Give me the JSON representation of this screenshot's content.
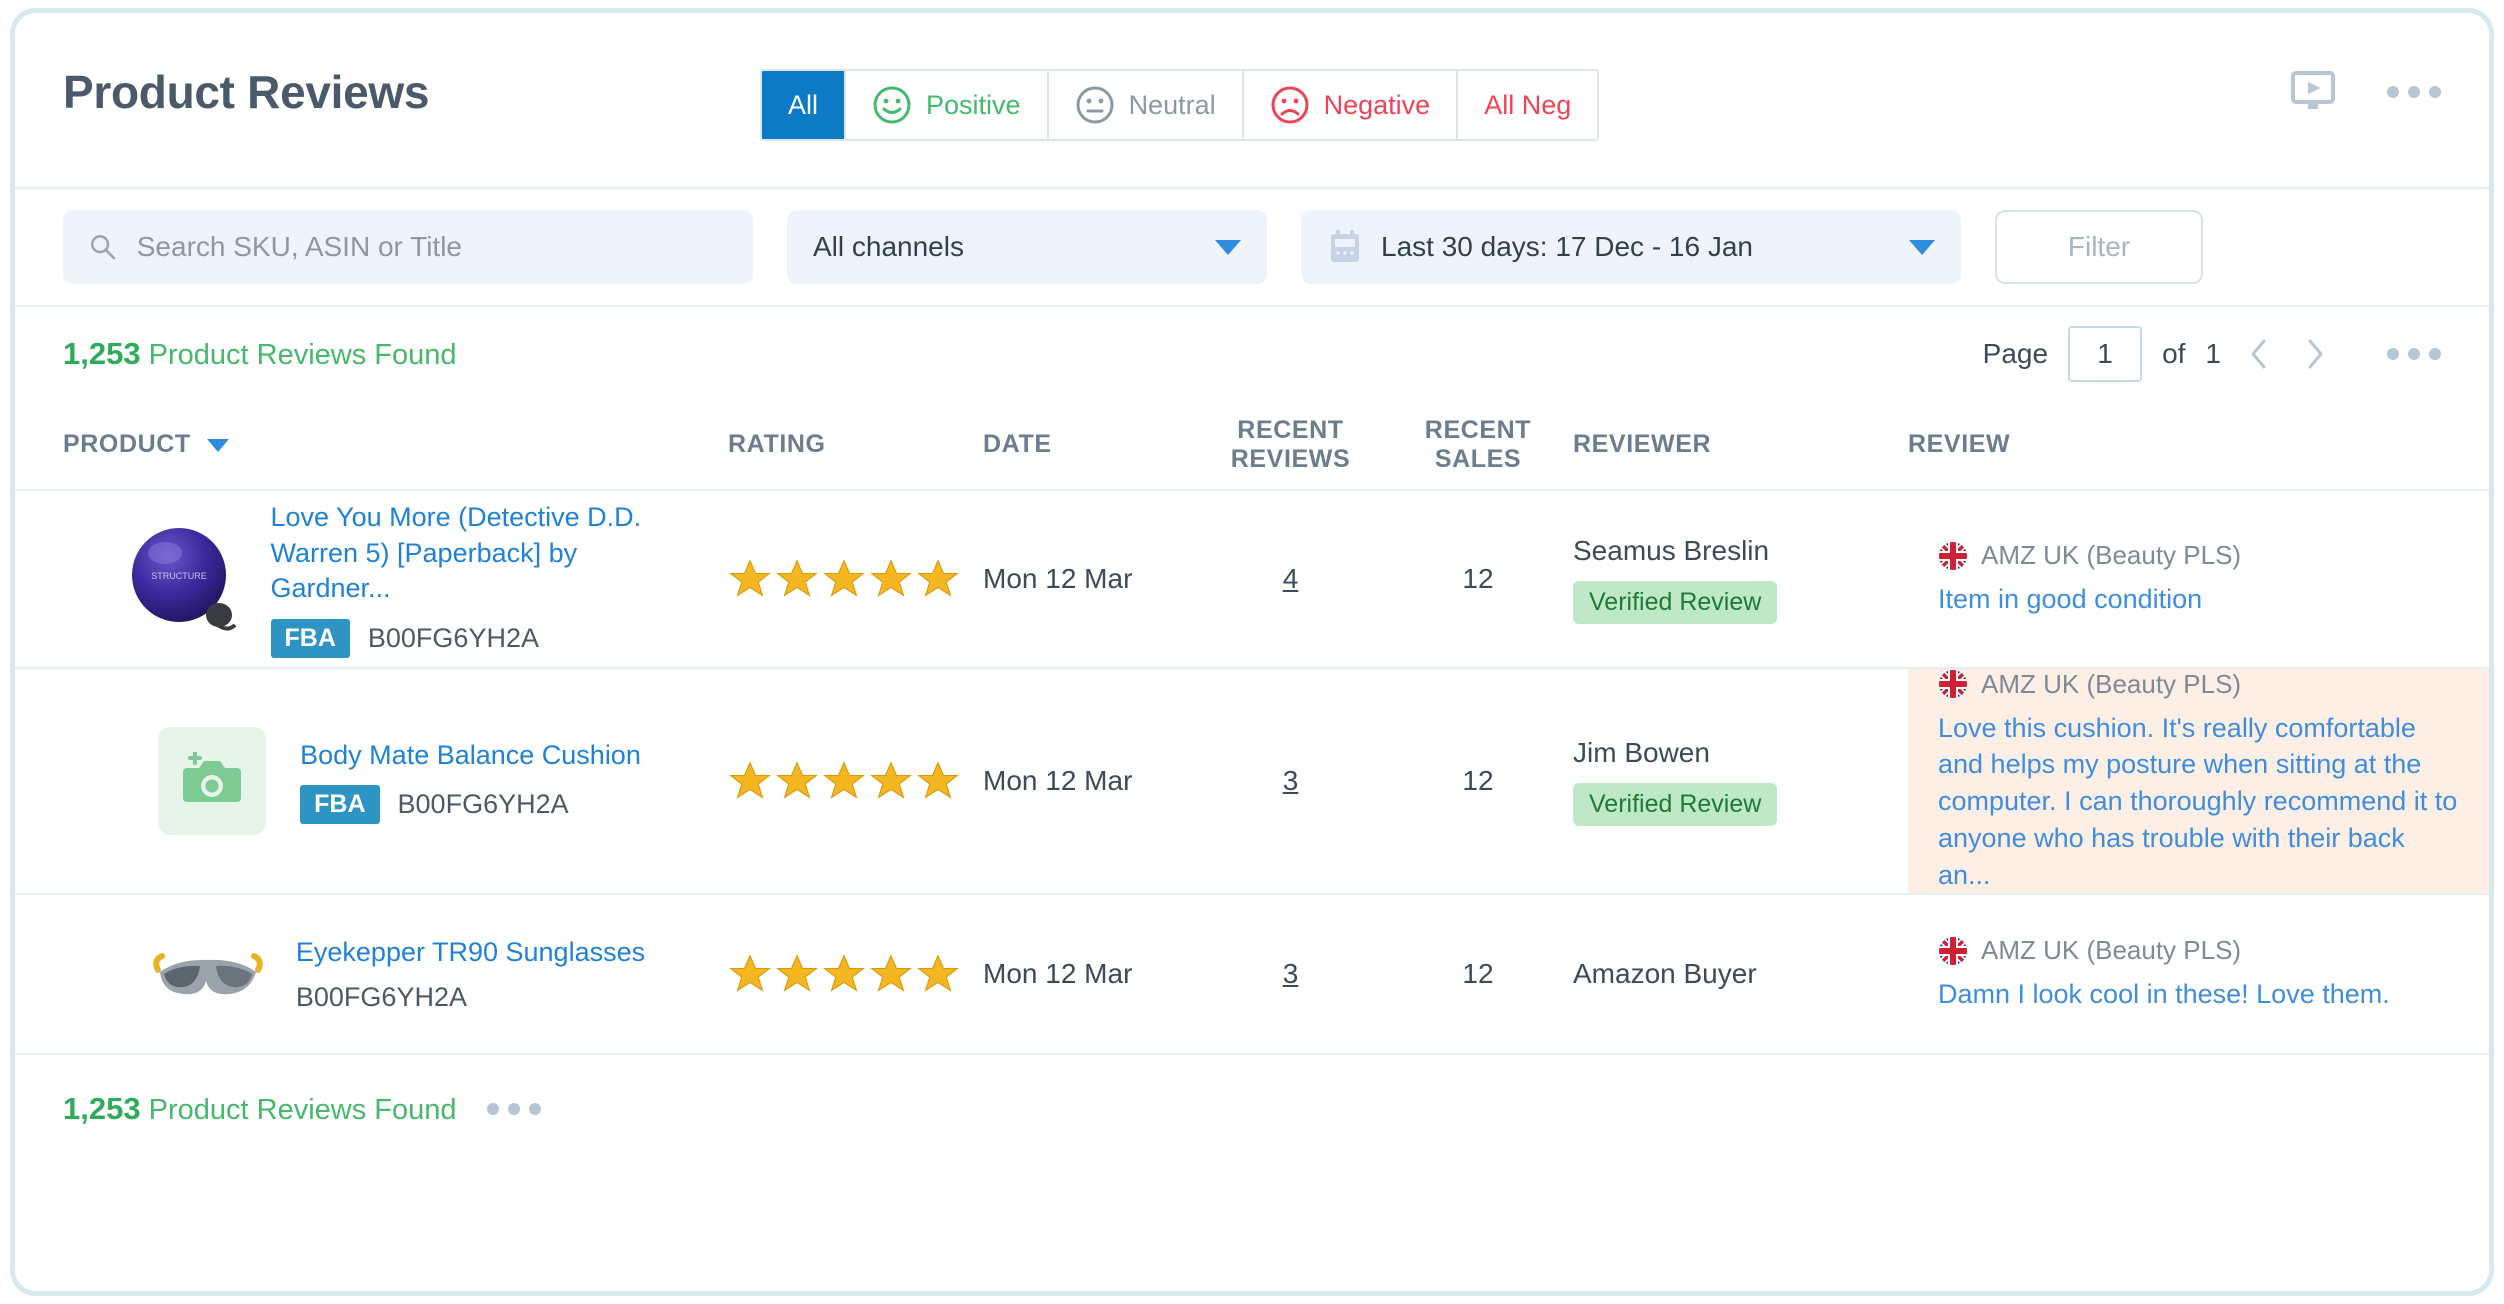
{
  "header": {
    "title": "Product Reviews",
    "tabs": [
      {
        "label": "All",
        "icon": "none",
        "state": "active"
      },
      {
        "label": "Positive",
        "icon": "smiley-happy-icon",
        "state": "default"
      },
      {
        "label": "Neutral",
        "icon": "smiley-neutral-icon",
        "state": "default"
      },
      {
        "label": "Negative",
        "icon": "smiley-sad-icon",
        "state": "default"
      },
      {
        "label": "All Neg",
        "icon": "none",
        "state": "default"
      }
    ],
    "actions": [
      {
        "name": "presentation-play-icon"
      },
      {
        "name": "more-options-icon"
      }
    ]
  },
  "filters": {
    "search_placeholder": "Search SKU, ASIN or Title",
    "search_value": "",
    "channel_selected": "All channels",
    "date_selected": "Last 30 days: 17 Dec - 16 Jan",
    "filter_button": "Filter"
  },
  "results": {
    "count": "1,253",
    "count_label": "Product Reviews Found",
    "page_label": "Page",
    "page_value": "1",
    "of_label": "of",
    "total_pages": "1"
  },
  "table": {
    "headers": {
      "product": "PRODUCT",
      "rating": "RATING",
      "date": "DATE",
      "recent_reviews_l1": "RECENT",
      "recent_reviews_l2": "REVIEWS",
      "recent_sales_l1": "RECENT",
      "recent_sales_l2": "SALES",
      "reviewer": "REVIEWER",
      "review": "REVIEW"
    },
    "rows": [
      {
        "title": "Love You More (Detective D.D. Warren 5) [Paperback] by Gardner...",
        "fba": "FBA",
        "has_fba": true,
        "asin": "B00FG6YH2A",
        "thumb": "exercise-ball-photo",
        "rating": 5,
        "date": "Mon 12 Mar",
        "recent_reviews": "4",
        "recent_sales": "12",
        "reviewer": "Seamus Breslin",
        "verified": "Verified Review",
        "has_verified": true,
        "channel": "AMZ UK (Beauty PLS)",
        "review_text": "Item in good condition",
        "highlighted": false
      },
      {
        "title": "Body Mate Balance Cushion",
        "fba": "FBA",
        "has_fba": true,
        "asin": "B00FG6YH2A",
        "thumb": "camera-placeholder-icon",
        "rating": 5,
        "date": "Mon 12 Mar",
        "recent_reviews": "3",
        "recent_sales": "12",
        "reviewer": "Jim Bowen",
        "verified": "Verified Review",
        "has_verified": true,
        "channel": "AMZ UK (Beauty PLS)",
        "review_text": "Love this cushion. It's really comfortable and helps my posture when sitting at the computer. I can thoroughly recommend it to anyone who has trouble with their back an...",
        "highlighted": true
      },
      {
        "title": "Eyekepper TR90 Sunglasses",
        "fba": "",
        "has_fba": false,
        "asin": "B00FG6YH2A",
        "thumb": "sunglasses-photo",
        "rating": 5,
        "date": "Mon 12 Mar",
        "recent_reviews": "3",
        "recent_sales": "12",
        "reviewer": "Amazon Buyer",
        "verified": "",
        "has_verified": false,
        "channel": "AMZ UK (Beauty PLS)",
        "review_text": "Damn I look cool in these! Love them.",
        "highlighted": false
      }
    ]
  },
  "footer": {
    "count": "1,253",
    "count_label": "Product Reviews Found"
  },
  "colors": {
    "accent_blue": "#0c7ac4",
    "link_blue": "#1f82d8",
    "green": "#46b96c",
    "red": "#ef4358",
    "star_gold": "#f5b721",
    "fba_teal": "#2e94c4",
    "highlight_peach": "#fdeee6"
  }
}
